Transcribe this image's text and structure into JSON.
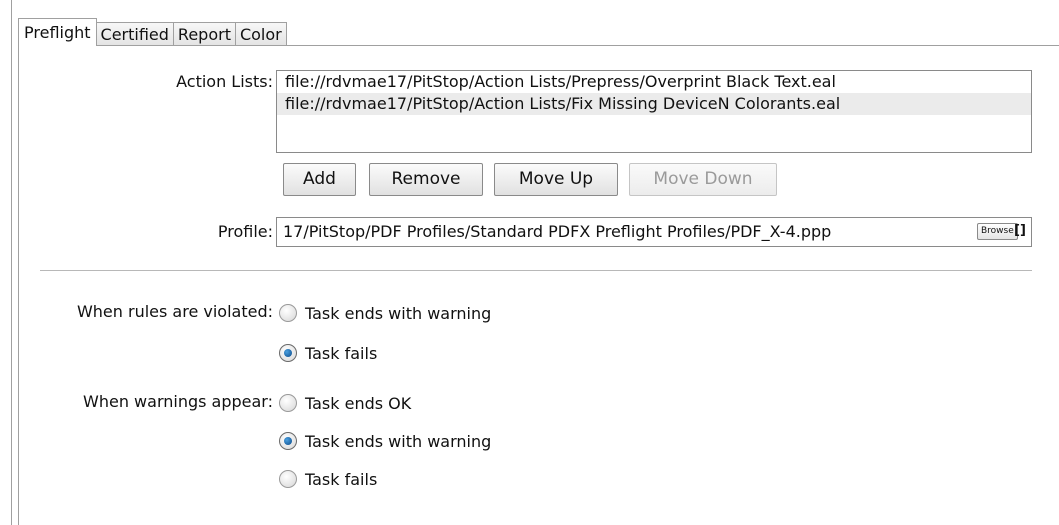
{
  "tabs": [
    {
      "label": "Preflight",
      "active": true
    },
    {
      "label": "Certified"
    },
    {
      "label": "Report"
    },
    {
      "label": "Color"
    }
  ],
  "action_lists": {
    "label": "Action Lists:",
    "items": [
      "file://rdvmae17/PitStop/Action Lists/Prepress/Overprint Black Text.eal",
      "file://rdvmae17/PitStop/Action Lists/Fix Missing DeviceN Colorants.eal"
    ]
  },
  "buttons": {
    "add": "Add",
    "remove": "Remove",
    "move_up": "Move Up",
    "move_down": "Move Down"
  },
  "profile": {
    "label": "Profile:",
    "value": "17/PitStop/PDF Profiles/Standard PDFX Preflight Profiles/PDF_X-4.ppp",
    "browse_label": "Browse",
    "bracket_glyph": "[]"
  },
  "rules_violated": {
    "label": "When rules are violated:",
    "options": [
      {
        "label": "Task ends with warning",
        "checked": false
      },
      {
        "label": "Task fails",
        "checked": true
      }
    ]
  },
  "warnings_appear": {
    "label": "When warnings appear:",
    "options": [
      {
        "label": "Task ends OK",
        "checked": false
      },
      {
        "label": "Task ends with warning",
        "checked": true
      },
      {
        "label": "Task fails",
        "checked": false
      }
    ]
  }
}
